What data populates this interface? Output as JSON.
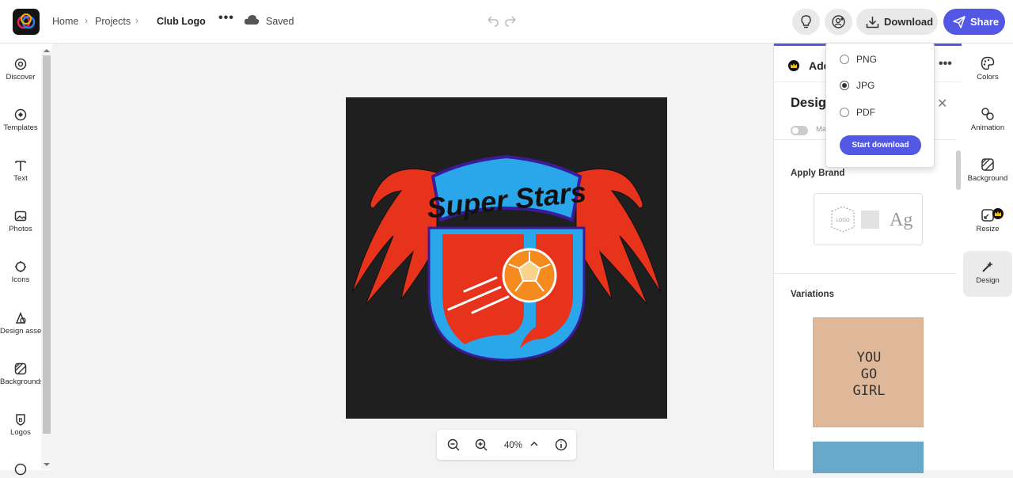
{
  "header": {
    "breadcrumb": [
      "Home",
      "Projects",
      "Club Logo"
    ],
    "more": "•••",
    "save_status": "Saved",
    "download_label": "Download",
    "share_label": "Share"
  },
  "left_sidebar": {
    "items": [
      {
        "label": "Discover",
        "icon": "discover-icon"
      },
      {
        "label": "Templates",
        "icon": "templates-icon"
      },
      {
        "label": "Text",
        "icon": "text-icon"
      },
      {
        "label": "Photos",
        "icon": "photos-icon"
      },
      {
        "label": "Icons",
        "icon": "icons-icon"
      },
      {
        "label": "Design assets",
        "icon": "design-assets-icon"
      },
      {
        "label": "Backgrounds",
        "icon": "backgrounds-icon"
      },
      {
        "label": "Logos",
        "icon": "logos-icon"
      }
    ]
  },
  "canvas": {
    "logo_text": "Super Stars",
    "colors": {
      "background": "#1f1f1f",
      "wings": "#e8331c",
      "shield_outer": "#29a7ea",
      "shield_inner": "#e8331c",
      "banner": "#29a7ea",
      "ball": "#f58a1f"
    }
  },
  "zoom": {
    "value": "40%"
  },
  "right_panel": {
    "add_label": "Add",
    "title": "Design",
    "toggle_label": "Ma",
    "apply_brand_label": "Apply Brand",
    "brand_card": {
      "logo_text": "LOGO",
      "font_glyph": "Ag"
    },
    "variations_label": "Variations",
    "variation_text": [
      "YOU",
      "GO",
      "GIRL"
    ]
  },
  "right_sidebar": {
    "items": [
      {
        "label": "Colors",
        "icon": "palette-icon"
      },
      {
        "label": "Animation",
        "icon": "animation-icon"
      },
      {
        "label": "Background",
        "icon": "background-icon"
      },
      {
        "label": "Resize",
        "icon": "resize-icon"
      },
      {
        "label": "Design",
        "icon": "magic-wand-icon",
        "active": true
      }
    ]
  },
  "download_menu": {
    "options": [
      {
        "label": "PNG",
        "selected": false
      },
      {
        "label": "JPG",
        "selected": true
      },
      {
        "label": "PDF",
        "selected": false
      }
    ],
    "start_label": "Start download"
  },
  "accent_color": "#5258e4"
}
